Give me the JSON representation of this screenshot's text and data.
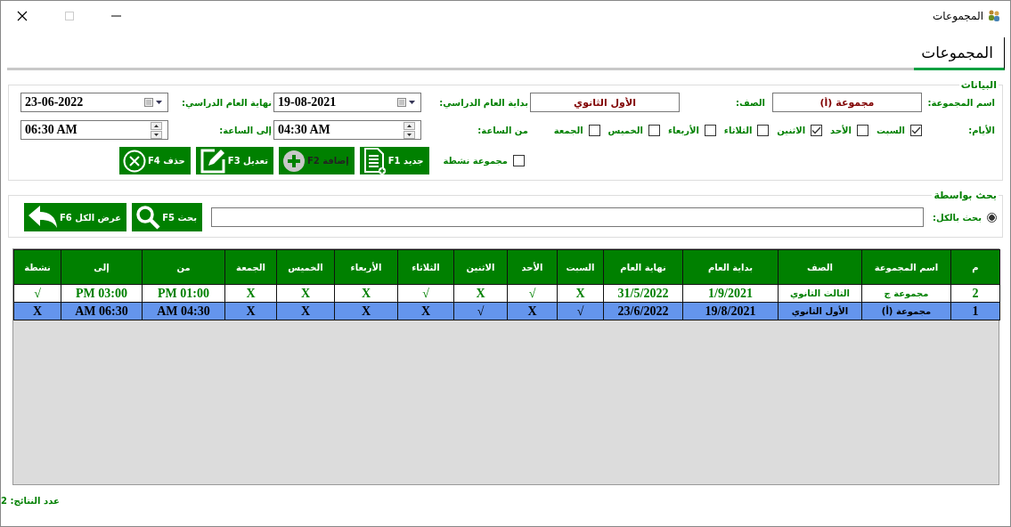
{
  "window": {
    "title": "المجموعات"
  },
  "tabs": [
    {
      "label": "المجموعات",
      "selected": true
    }
  ],
  "details": {
    "title": "البيانات",
    "group_name": {
      "label": "اسم المجموعة:",
      "value": "مجموعة (أ)"
    },
    "grade": {
      "label": "الصف:",
      "value": "الأول الثانوي"
    },
    "year_start": {
      "label": "بداية العام الدراسي:",
      "value": "19-08-2021"
    },
    "year_end": {
      "label": "نهاية العام الدراسي:",
      "value": "23-06-2022"
    },
    "days_label": "الأيام:",
    "days": [
      {
        "label": "السبت",
        "checked": true
      },
      {
        "label": "الأحد",
        "checked": false
      },
      {
        "label": "الاثنين",
        "checked": true
      },
      {
        "label": "الثلاثاء",
        "checked": false
      },
      {
        "label": "الأربعاء",
        "checked": false
      },
      {
        "label": "الخميس",
        "checked": false
      },
      {
        "label": "الجمعة",
        "checked": false
      }
    ],
    "time_from": {
      "label": "من الساعة:",
      "value": "04:30 AM"
    },
    "time_to": {
      "label": "إلى الساعة:",
      "value": "06:30 AM"
    },
    "active": {
      "label": "مجموعة نشطة",
      "checked": false
    },
    "buttons": [
      {
        "label": "جديد F1",
        "kind": "new",
        "disabled": false
      },
      {
        "label": "إضافة F2",
        "kind": "add",
        "disabled": true
      },
      {
        "label": "تعديل F3",
        "kind": "edit",
        "disabled": false
      },
      {
        "label": "حذف F4",
        "kind": "delete",
        "disabled": false
      }
    ]
  },
  "search": {
    "title": "بحث بواسطة",
    "option": {
      "label": "بحث بالكل:",
      "selected": true
    },
    "buttons": [
      {
        "label": "بحث F5",
        "kind": "search"
      },
      {
        "label": "عرض الكل F6",
        "kind": "show_all"
      }
    ]
  },
  "table": {
    "columns": [
      "م",
      "اسم المجموعة",
      "الصف",
      "بداية العام",
      "نهاية العام",
      "السبت",
      "الأحد",
      "الاثنين",
      "الثلاثاء",
      "الأربعاء",
      "الخميس",
      "الجمعة",
      "من",
      "إلى",
      "نشطة"
    ],
    "rows": [
      {
        "selected": false,
        "cells": [
          "2",
          "مجموعة ج",
          "الثالث الثانوي",
          "1/9/2021",
          "31/5/2022",
          "X",
          "√",
          "X",
          "√",
          "X",
          "X",
          "X",
          "PM 01:00",
          "PM 03:00",
          "√"
        ]
      },
      {
        "selected": true,
        "cells": [
          "1",
          "مجموعة (أ)",
          "الأول الثانوي",
          "19/8/2021",
          "23/6/2022",
          "√",
          "X",
          "√",
          "X",
          "X",
          "X",
          "X",
          "AM 04:30",
          "AM 06:30",
          "X"
        ]
      }
    ]
  },
  "status_bar": {
    "result_count": "عدد النتائج: 2"
  }
}
